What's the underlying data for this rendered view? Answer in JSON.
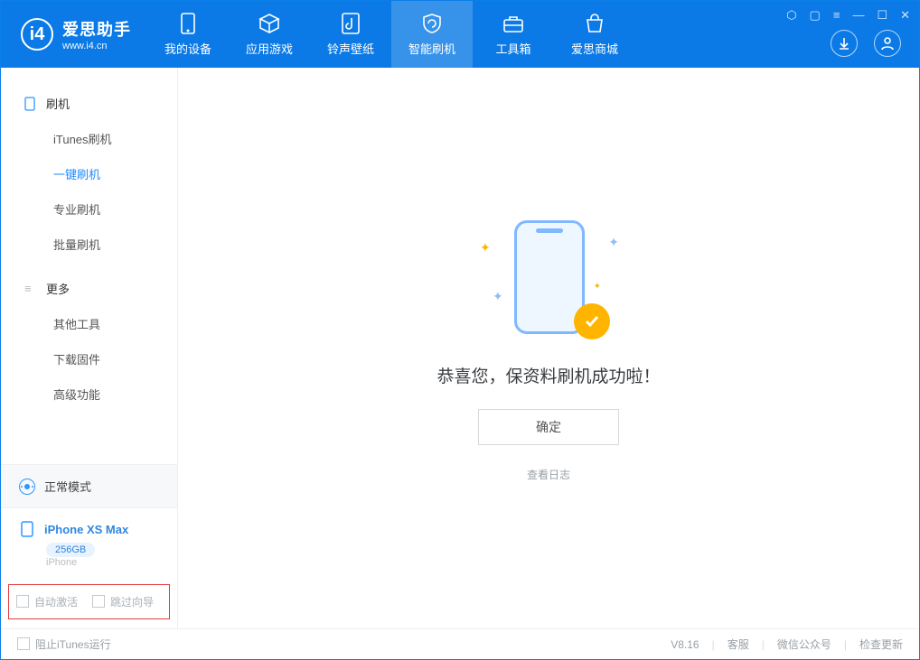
{
  "app": {
    "name_cn": "爱思助手",
    "url": "www.i4.cn"
  },
  "nav": {
    "items": [
      {
        "label": "我的设备"
      },
      {
        "label": "应用游戏"
      },
      {
        "label": "铃声壁纸"
      },
      {
        "label": "智能刷机"
      },
      {
        "label": "工具箱"
      },
      {
        "label": "爱思商城"
      }
    ]
  },
  "sidebar": {
    "group1": {
      "title": "刷机",
      "items": [
        "iTunes刷机",
        "一键刷机",
        "专业刷机",
        "批量刷机"
      ]
    },
    "group2": {
      "title": "更多",
      "items": [
        "其他工具",
        "下载固件",
        "高级功能"
      ]
    },
    "mode": "正常模式",
    "device": {
      "name": "iPhone XS Max",
      "capacity": "256GB",
      "os": "iPhone"
    },
    "options": {
      "auto_activate": "自动激活",
      "skip_guide": "跳过向导"
    }
  },
  "main": {
    "message": "恭喜您，保资料刷机成功啦！",
    "ok": "确定",
    "view_log": "查看日志"
  },
  "status": {
    "block_itunes": "阻止iTunes运行",
    "version": "V8.16",
    "links": [
      "客服",
      "微信公众号",
      "检查更新"
    ]
  }
}
